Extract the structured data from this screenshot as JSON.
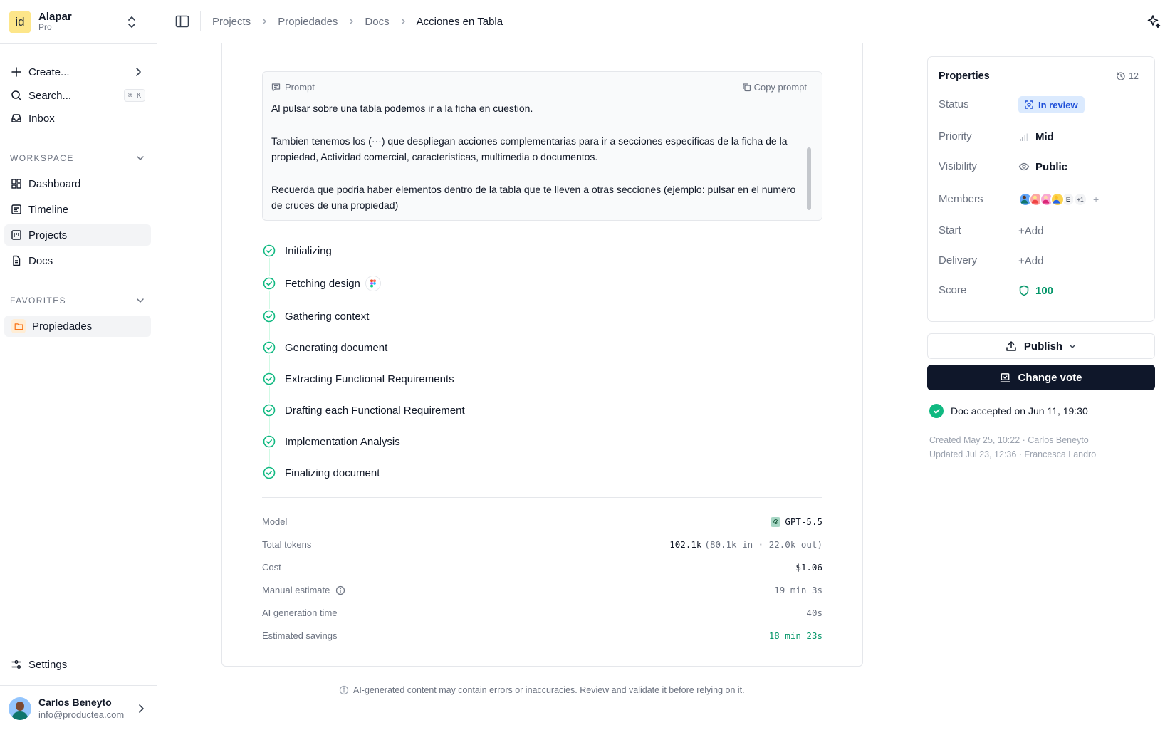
{
  "workspace": {
    "logo": "id",
    "name": "Alapar",
    "plan": "Pro"
  },
  "nav": {
    "create": "Create...",
    "search": "Search...",
    "search_shortcut": "⌘ K",
    "inbox": "Inbox"
  },
  "workspace_section": {
    "heading": "WORKSPACE",
    "items": [
      {
        "label": "Dashboard",
        "icon": "dashboard-icon"
      },
      {
        "label": "Timeline",
        "icon": "timeline-icon"
      },
      {
        "label": "Projects",
        "icon": "projects-icon",
        "active": true
      },
      {
        "label": "Docs",
        "icon": "docs-icon"
      }
    ]
  },
  "favorites_section": {
    "heading": "FAVORITES",
    "items": [
      {
        "label": "Propiedades",
        "icon": "folder-icon"
      }
    ]
  },
  "settings": {
    "label": "Settings"
  },
  "user": {
    "name": "Carlos Beneyto",
    "email": "info@productea.com"
  },
  "breadcrumb": [
    "Projects",
    "Propiedades",
    "Docs",
    "Acciones en Tabla"
  ],
  "prompt": {
    "label": "Prompt",
    "copy_label": "Copy prompt",
    "paragraphs": [
      "Al pulsar sobre una tabla podemos ir a la ficha en cuestion.",
      "Tambien tenemos los (···) que despliegan acciones complementarias para ir a secciones especificas de la ficha de la propiedad, Actividad comercial, caracteristicas, multimedia o documentos.",
      "Recuerda que podria haber elementos dentro de la tabla que te lleven a otras secciones (ejemplo: pulsar en el numero de cruces de una propiedad)"
    ]
  },
  "steps": [
    "Initializing",
    "Fetching design",
    "Gathering context",
    "Generating document",
    "Extracting Functional Requirements",
    "Drafting each Functional Requirement",
    "Implementation Analysis",
    "Finalizing document"
  ],
  "meta": {
    "model_label": "Model",
    "model_value": "GPT-5.5",
    "tokens_label": "Total tokens",
    "tokens_value": "102.1k",
    "tokens_detail": "(80.1k in · 22.0k out)",
    "cost_label": "Cost",
    "cost_value": "$1.06",
    "manual_label": "Manual estimate",
    "manual_value": "19 min 3s",
    "ai_time_label": "AI generation time",
    "ai_time_value": "40s",
    "savings_label": "Estimated savings",
    "savings_value": "18 min 23s"
  },
  "disclaimer": "AI-generated content may contain errors or inaccuracies. Review and validate it before relying on it.",
  "properties": {
    "title": "Properties",
    "history_count": "12",
    "status_label": "Status",
    "status_value": "In review",
    "priority_label": "Priority",
    "priority_value": "Mid",
    "visibility_label": "Visibility",
    "visibility_value": "Public",
    "members_label": "Members",
    "members_initial": "E",
    "members_more": "+1",
    "members_add": "+",
    "start_label": "Start",
    "start_value": "+Add",
    "delivery_label": "Delivery",
    "delivery_value": "+Add",
    "score_label": "Score",
    "score_value": "100"
  },
  "actions": {
    "publish": "Publish",
    "change_vote": "Change vote"
  },
  "accepted": "Doc accepted on Jun 11, 19:30",
  "history": {
    "created": "Created May 25, 10:22 · Carlos Beneyto",
    "updated": "Updated Jul 23, 12:36 · Francesca Landro"
  },
  "colors": {
    "accent_green": "#10b981",
    "primary_dark": "#0f172a",
    "review_blue": "#1d4ed8"
  }
}
